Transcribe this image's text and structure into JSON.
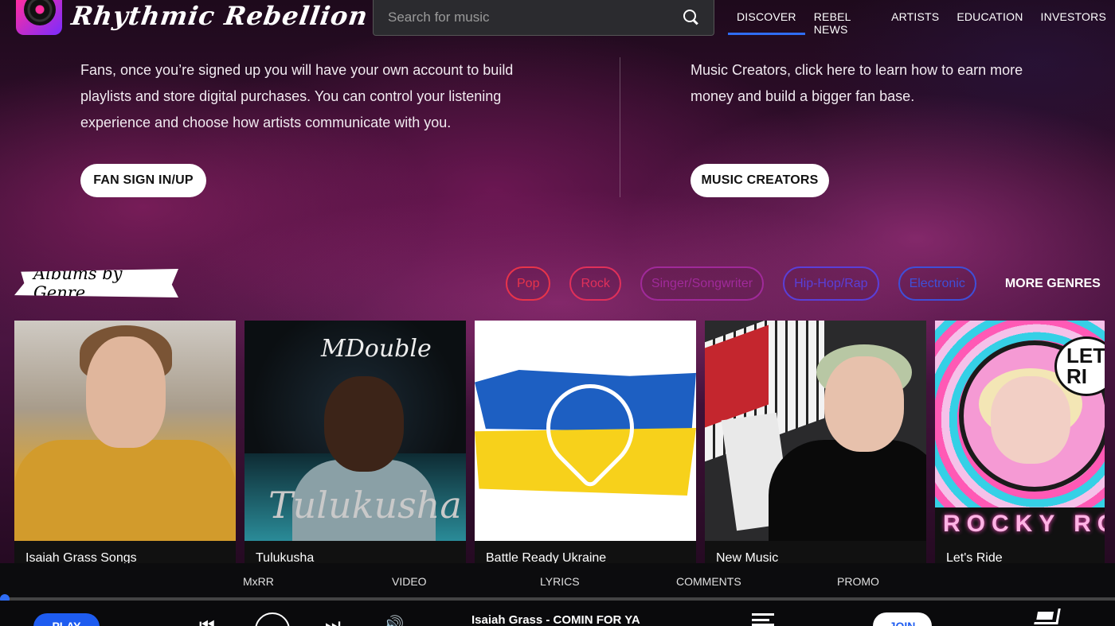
{
  "header": {
    "brand": "Rhythmic Rebellion",
    "search_placeholder": "Search for music",
    "nav": [
      "DISCOVER",
      "REBEL NEWS",
      "ARTISTS",
      "EDUCATION",
      "INVESTORS"
    ],
    "active_nav": "DISCOVER"
  },
  "hero": {
    "fans_text": "Fans, once you’re signed up you will have your own account to build playlists and store digital purchases. You can control your listening experience and choose how artists communicate with you.",
    "fans_button": "FAN SIGN IN/UP",
    "creators_text": "Music Creators, click here to learn how to earn more money and build a bigger fan base.",
    "creators_button": "MUSIC CREATORS"
  },
  "genres_section": {
    "title": "Albums by Genre",
    "genres": [
      {
        "label": "Pop",
        "color": "#e8344a"
      },
      {
        "label": "Rock",
        "color": "#e0305a"
      },
      {
        "label": "Singer/Songwriter",
        "color": "#a02a9a"
      },
      {
        "label": "Hip-Hop/Rap",
        "color": "#5a3fd8"
      },
      {
        "label": "Electronic",
        "color": "#3f4fd8"
      }
    ],
    "more_label": "MORE GENRES"
  },
  "albums": [
    {
      "title": "Isaiah Grass Songs"
    },
    {
      "title": "Tulukusha",
      "cover_text": "MDouble",
      "cover_script": "Tulukusha"
    },
    {
      "title": "Battle Ready Ukraine"
    },
    {
      "title": "New Music"
    },
    {
      "title": "Let's Ride",
      "cover_bubble": "LET RI",
      "cover_neon": "ROCKY RO"
    }
  ],
  "player": {
    "tabs": [
      "MxRR",
      "VIDEO",
      "LYRICS",
      "COMMENTS",
      "PROMO"
    ],
    "play_label": "PLAY",
    "now_playing": "Isaiah Grass - COMIN FOR YA",
    "join_label": "JOIN",
    "progress": 0
  },
  "colors": {
    "accent": "#2f6df5",
    "background": "#0a0810"
  }
}
